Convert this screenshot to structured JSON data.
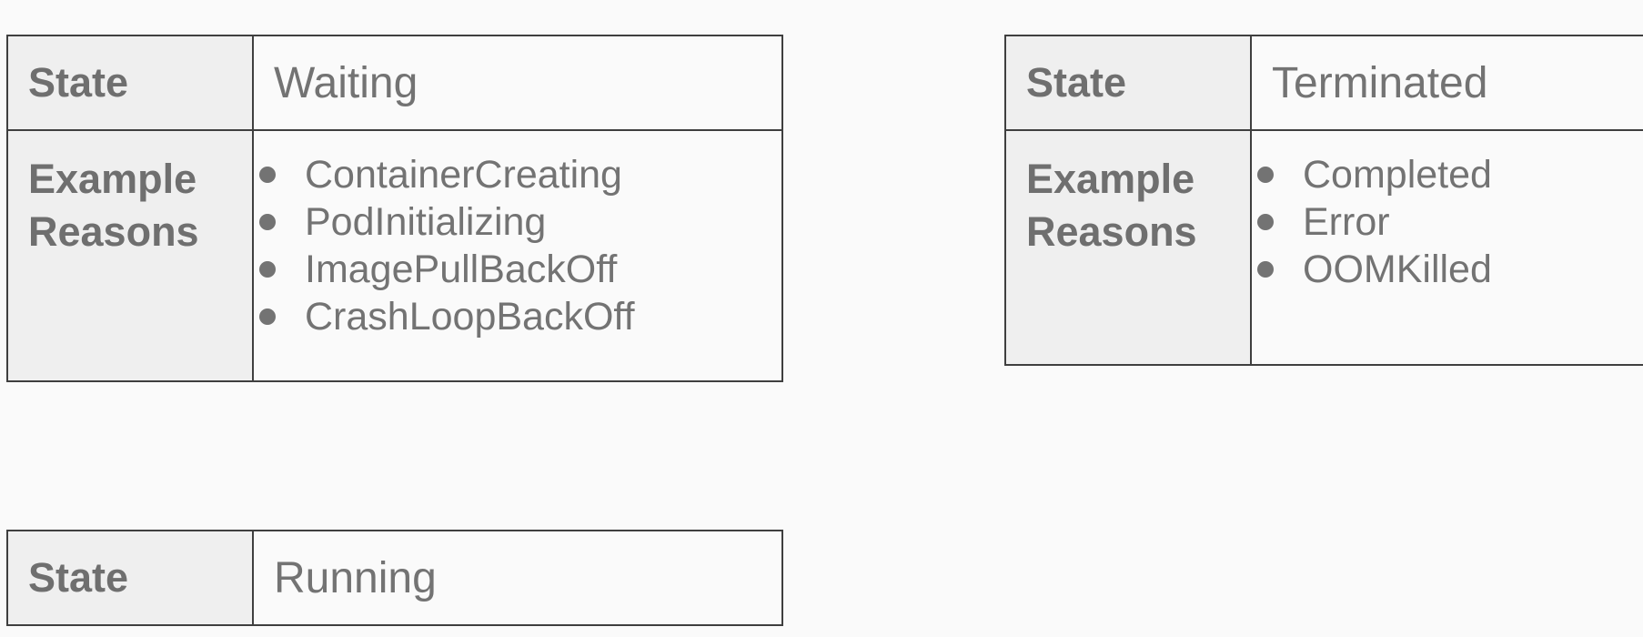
{
  "header_label": "State",
  "reasons_label_line1": "Example",
  "reasons_label_line2": "Reasons",
  "tables": {
    "waiting": {
      "state": "Waiting",
      "reasons": [
        "ContainerCreating",
        "PodInitializing",
        "ImagePullBackOff",
        "CrashLoopBackOff"
      ]
    },
    "terminated": {
      "state": "Terminated",
      "reasons": [
        "Completed",
        "Error",
        "OOMKilled"
      ]
    },
    "running": {
      "state": "Running"
    }
  }
}
